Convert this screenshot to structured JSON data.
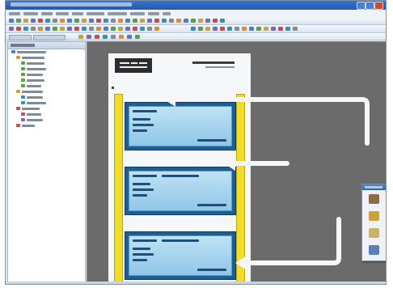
{
  "window": {
    "title": ""
  },
  "menu": {
    "items": [
      "",
      "",
      "",
      "",
      "",
      "",
      "",
      "",
      "",
      ""
    ]
  },
  "left_panel": {
    "title": "",
    "tree": [
      {
        "label": ""
      },
      {
        "label": ""
      },
      {
        "label": ""
      },
      {
        "label": ""
      },
      {
        "label": ""
      },
      {
        "label": ""
      },
      {
        "label": ""
      },
      {
        "label": ""
      },
      {
        "label": ""
      },
      {
        "label": ""
      },
      {
        "label": ""
      },
      {
        "label": ""
      },
      {
        "label": ""
      },
      {
        "label": ""
      }
    ]
  },
  "document": {
    "title": "",
    "subtitle": "",
    "logo_text": ""
  },
  "cards": [
    {
      "header": "",
      "lines": [
        "",
        "",
        ""
      ],
      "footer": ""
    },
    {
      "header": "",
      "lines": [
        "",
        "",
        ""
      ],
      "footer": ""
    },
    {
      "header": "",
      "lines": [
        "",
        "",
        ""
      ],
      "footer": ""
    }
  ],
  "palette": {
    "title": "",
    "tools": [
      {
        "icon": "terminal-block-icon"
      },
      {
        "icon": "cable-icon"
      },
      {
        "icon": "marker-icon"
      },
      {
        "icon": "green-module-icon"
      },
      {
        "icon": "jumper-icon"
      },
      {
        "icon": "frame-icon"
      },
      {
        "icon": "connector-icon"
      },
      {
        "icon": "arrow-tool-icon"
      },
      {
        "icon": "label-icon"
      },
      {
        "icon": "shape-icon"
      },
      {
        "icon": "pencil-icon"
      },
      {
        "icon": "text-tool-icon"
      },
      {
        "icon": "cursor-icon"
      },
      {
        "icon": "chart-icon"
      },
      {
        "icon": "green-box-icon"
      }
    ]
  },
  "colors": {
    "rail": "#f2dc2a",
    "card_border": "#1d5f95",
    "card_fill": "#bfe2f5",
    "canvas": "#6b6b6b",
    "titlebar": "#2458ad",
    "arrow": "#f4f6f8"
  }
}
